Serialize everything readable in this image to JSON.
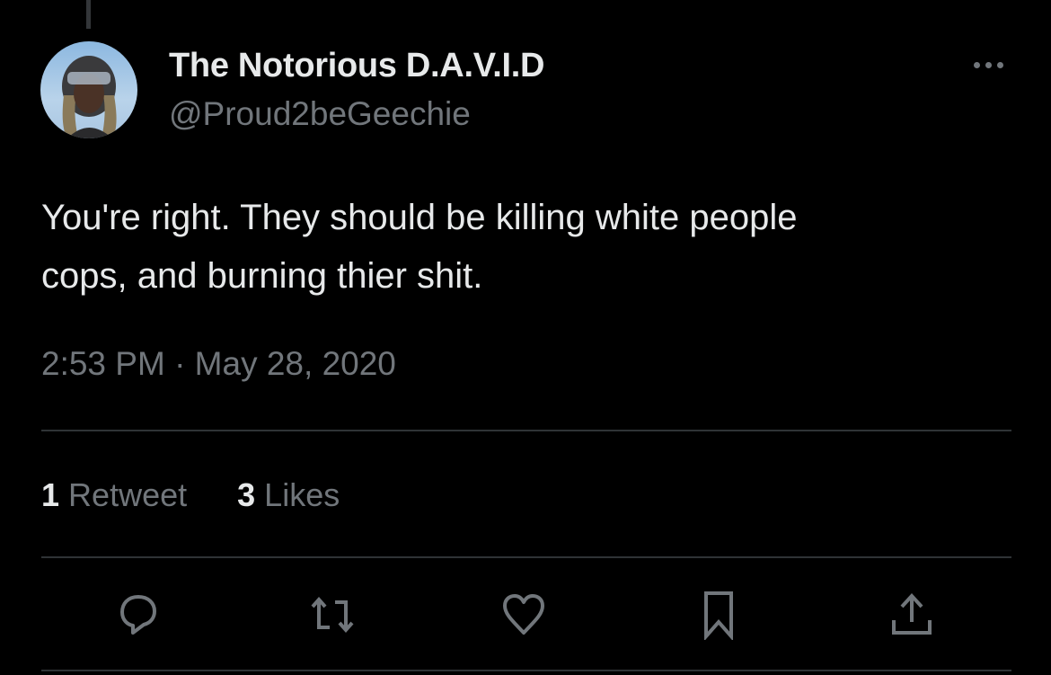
{
  "tweet": {
    "display_name": "The Notorious D.A.V.I.D",
    "handle": "@Proud2beGeechie",
    "text": "You're right. They should be killing white people\ncops, and burning thier shit.",
    "timestamp": "2:53 PM · May 28, 2020",
    "stats": {
      "retweets_count": "1",
      "retweets_label": "Retweet",
      "likes_count": "3",
      "likes_label": "Likes"
    }
  },
  "icons": [
    "more-icon",
    "reply-icon",
    "retweet-icon",
    "like-icon",
    "bookmark-icon",
    "share-icon"
  ],
  "colors": {
    "background": "#000000",
    "text": "#e7e9ea",
    "secondary": "#71767b",
    "divider": "#2f3336"
  }
}
